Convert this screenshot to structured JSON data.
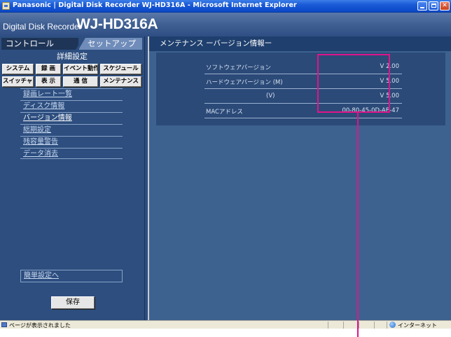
{
  "window": {
    "title": "Panasonic | Digital Disk Recorder WJ-HD316A - Microsoft Internet Explorer"
  },
  "app_header": {
    "small_text": "Digital Disk Recorder",
    "model": "WJ-HD316A"
  },
  "left_panel": {
    "tabs": [
      {
        "label": "コントロール"
      },
      {
        "label": "セットアップ"
      }
    ],
    "subheading": "詳細設定",
    "button_rows": [
      [
        "システム",
        "録 画",
        "イベント動作",
        "スケジュール"
      ],
      [
        "スイッチャー",
        "表 示",
        "通 信",
        "メンテナンス"
      ]
    ],
    "menu_items": [
      "録画レート一覧",
      "ディスク情報",
      "バージョン情報",
      "総期設定",
      "残容量警告",
      "データ消去"
    ],
    "easy_setup_link": "簡単設定へ",
    "save_button": "保存"
  },
  "right_panel": {
    "heading": "メンテナンス ーバージョン情報ー",
    "rows": [
      {
        "label": "ソフトウェアバージョン",
        "value": "V 2.00"
      },
      {
        "label": "ハードウェアバージョン (M)",
        "value": "V 5.00"
      },
      {
        "label": "(V)",
        "value": "V 5.00"
      },
      {
        "label": "MACアドレス",
        "value": "00-80-45-0D-AE-47"
      }
    ]
  },
  "statusbar": {
    "text": "ページが表示されました",
    "zone": "インターネット"
  },
  "colors": {
    "highlight": "#e0148a",
    "title_bar": "#0a47c6",
    "panel_bg": "#2d4e7f"
  }
}
